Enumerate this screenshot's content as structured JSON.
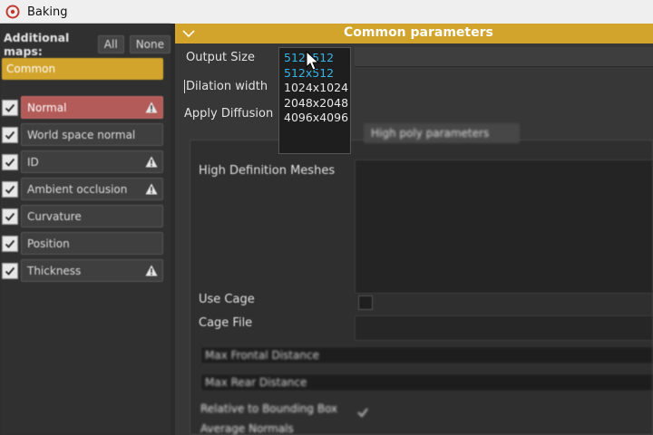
{
  "window": {
    "title": "Baking"
  },
  "left_panel": {
    "additional_maps_label": "Additional maps:",
    "all_button": "All",
    "none_button": "None",
    "common_tab": "Common",
    "maps": [
      {
        "label": "Normal",
        "checked": true,
        "warning": true,
        "selected": true
      },
      {
        "label": "World space normal",
        "checked": true,
        "warning": false,
        "selected": false
      },
      {
        "label": "ID",
        "checked": true,
        "warning": true,
        "selected": false
      },
      {
        "label": "Ambient occlusion",
        "checked": true,
        "warning": true,
        "selected": false
      },
      {
        "label": "Curvature",
        "checked": true,
        "warning": false,
        "selected": false
      },
      {
        "label": "Position",
        "checked": true,
        "warning": false,
        "selected": false
      },
      {
        "label": "Thickness",
        "checked": true,
        "warning": true,
        "selected": false
      }
    ]
  },
  "right_panel": {
    "header": "Common parameters",
    "output_size_label": "Output Size",
    "dilation_width_label": "Dilation width",
    "apply_diffusion_label": "Apply Diffusion",
    "output_size_options": [
      "512x512",
      "512x512",
      "1024x1024",
      "2048x2048",
      "4096x4096"
    ],
    "highlighted_options": [
      0,
      1
    ],
    "high_poly_tab": "High poly parameters",
    "high_def_meshes_label": "High Definition Meshes",
    "use_cage_label": "Use Cage",
    "cage_file_label": "Cage File",
    "max_frontal_distance": "Max Frontal Distance",
    "max_rear_distance": "Max Rear Distance",
    "relative_to_bbox_label": "Relative to Bounding Box",
    "average_normals_label": "Average Normals"
  },
  "colors": {
    "accent": "#d2a42c",
    "selected_item": "#b35b58",
    "highlight_text": "#36b4e6"
  }
}
